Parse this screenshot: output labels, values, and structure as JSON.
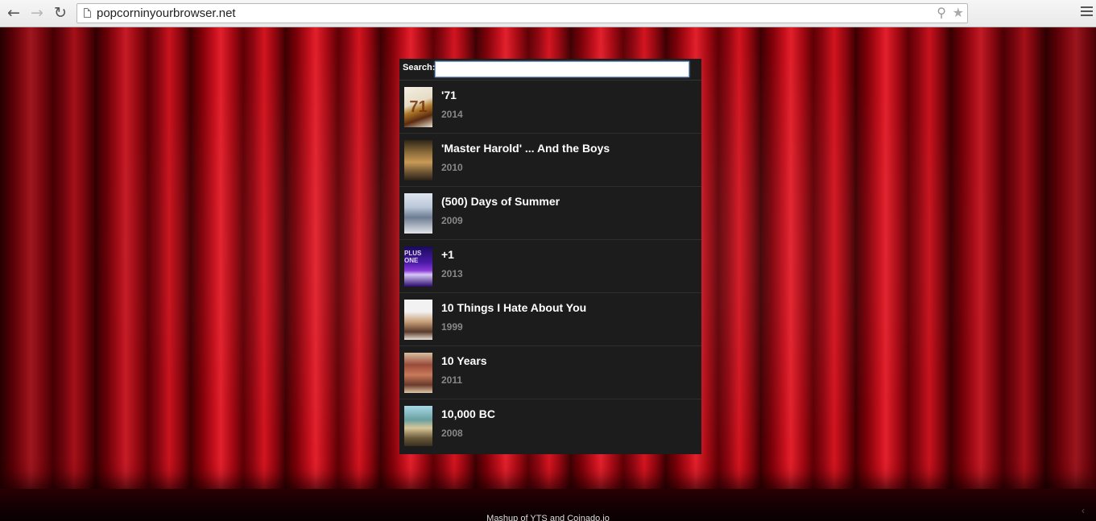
{
  "browser": {
    "url": "popcorninyourbrowser.net",
    "icons": {
      "back": "back-arrow-icon",
      "forward": "forward-arrow-icon",
      "reload": "reload-icon",
      "search": "search-icon",
      "bookmark": "star-icon",
      "menu": "hamburger-menu-icon"
    }
  },
  "search": {
    "label": "Search:",
    "value": "",
    "placeholder": ""
  },
  "movies": [
    {
      "title": "'71",
      "year": "2014",
      "poster": "71"
    },
    {
      "title": "'Master Harold' ... And the Boys",
      "year": "2010",
      "poster": ""
    },
    {
      "title": "(500) Days of Summer",
      "year": "2009",
      "poster": ""
    },
    {
      "title": "+1",
      "year": "2013",
      "poster": "PLUS ONE"
    },
    {
      "title": "10 Things I Hate About You",
      "year": "1999",
      "poster": ""
    },
    {
      "title": "10 Years",
      "year": "2011",
      "poster": ""
    },
    {
      "title": "10,000 BC",
      "year": "2008",
      "poster": ""
    }
  ],
  "footer": {
    "text": "Mashup of YTS and Coinado.io"
  },
  "colors": {
    "curtain": "#c4101c",
    "panel": "#1c1c1c",
    "title": "#ffffff",
    "year": "#888888"
  }
}
